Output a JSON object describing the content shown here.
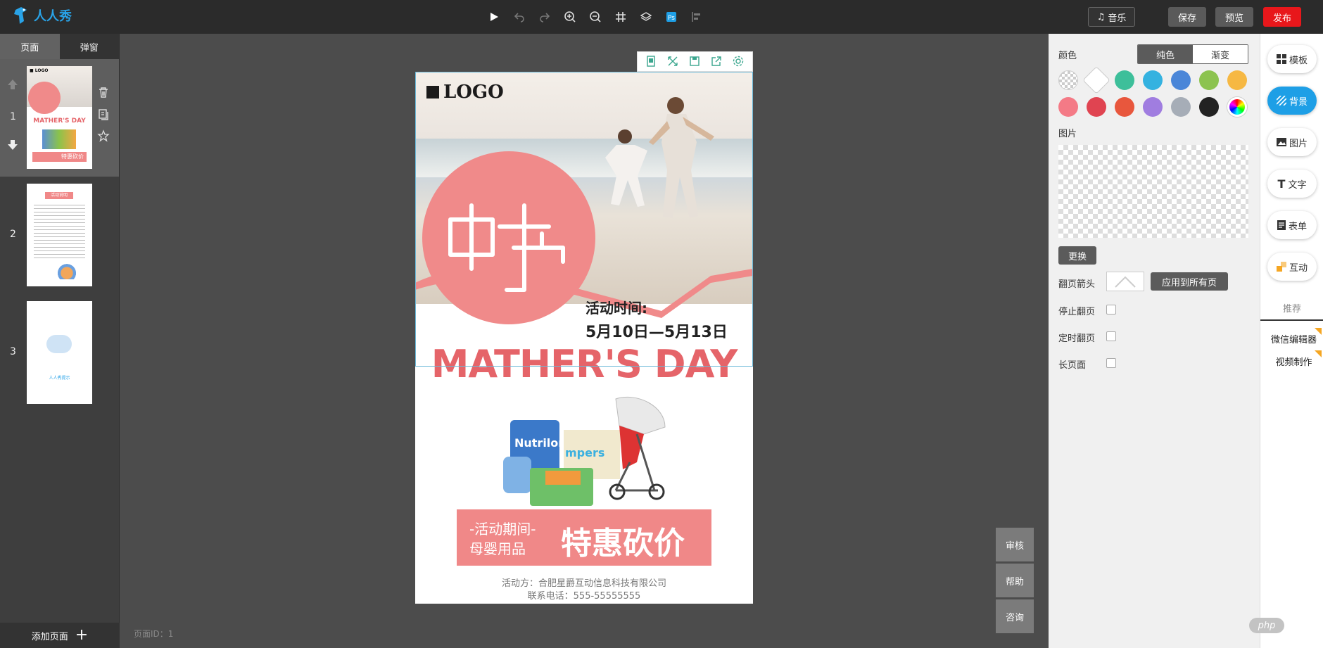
{
  "app": {
    "brand": "人人秀"
  },
  "toolbar": {
    "music_label": "音乐",
    "save_label": "保存",
    "preview_label": "预览",
    "publish_label": "发布"
  },
  "left": {
    "tabs": [
      {
        "label": "页面"
      },
      {
        "label": "弹窗"
      }
    ],
    "pages": [
      {
        "num": "1"
      },
      {
        "num": "2"
      },
      {
        "num": "3"
      }
    ],
    "add_page_label": "添加页面"
  },
  "thumb3": {
    "text": "人人秀提示"
  },
  "thumb2": {
    "title": "活动说明"
  },
  "thumb1": {
    "logo": "■ LOGO",
    "title": "MATHER'S DAY",
    "band": "特惠砍价"
  },
  "canvas": {
    "logo": "LOGO",
    "time_label": "活动时间:",
    "time_value": "5月10日—5月13日",
    "headline": "MATHER'S DAY",
    "band_line1": "-活动期间-",
    "band_line2": "母婴用品",
    "band_big": "特惠砍价",
    "footer1": "活动方：合肥星爵互动信息科技有限公司",
    "footer2": "联系电话：555-55555555"
  },
  "page_id": "页面ID：1",
  "side_buttons": [
    {
      "label": "审核"
    },
    {
      "label": "帮助"
    },
    {
      "label": "咨询"
    }
  ],
  "props": {
    "color_label": "颜色",
    "solid_label": "纯色",
    "gradient_label": "渐变",
    "swatches": [
      "transparent",
      "#ffffff",
      "#3dbf9a",
      "#34b2e0",
      "#4a86d8",
      "#8cc34f",
      "#f6b843",
      "#f47a86",
      "#e04451",
      "#e8573d",
      "#a07de0",
      "#a6adb7",
      "#222222",
      "rainbow"
    ],
    "image_label": "图片",
    "replace_label": "更换",
    "flip_arrow_label": "翻页箭头",
    "apply_all_label": "应用到所有页",
    "stop_flip_label": "停止翻页",
    "timed_flip_label": "定时翻页",
    "long_page_label": "长页面"
  },
  "rail": {
    "items": [
      {
        "label": "模板"
      },
      {
        "label": "背景"
      },
      {
        "label": "图片"
      },
      {
        "label": "文字"
      },
      {
        "label": "表单"
      },
      {
        "label": "互动"
      }
    ],
    "recommend_label": "推荐",
    "links": [
      {
        "label": "微信编辑器"
      },
      {
        "label": "视频制作"
      }
    ]
  },
  "watermark": "php"
}
